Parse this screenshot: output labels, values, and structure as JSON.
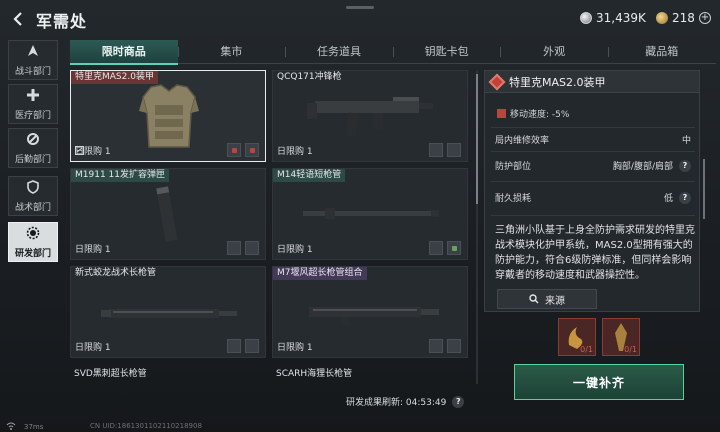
{
  "header": {
    "title": "军需处",
    "back_icon": "back-arrow-icon",
    "currency_coins": "31,439K",
    "currency_tokens": "218"
  },
  "sidebar": {
    "items": [
      {
        "label": "战斗部门",
        "icon": "combat-icon",
        "active": false
      },
      {
        "label": "医疗部门",
        "icon": "medical-cross-icon",
        "active": false
      },
      {
        "label": "后勤部门",
        "icon": "logistics-icon",
        "active": false
      },
      {
        "label": "战术部门",
        "icon": "shield-icon",
        "active": false
      },
      {
        "label": "研发部门",
        "icon": "rd-gear-icon",
        "active": true
      }
    ]
  },
  "tabs": [
    {
      "label": "限时商品",
      "active": true
    },
    {
      "label": "集市",
      "active": false
    },
    {
      "label": "任务道具",
      "active": false
    },
    {
      "label": "钥匙卡包",
      "active": false
    },
    {
      "label": "外观",
      "active": false
    },
    {
      "label": "藏品箱",
      "active": false
    }
  ],
  "items": [
    {
      "name": "特里克MAS2.0装甲",
      "limit": "日限购 1",
      "selected": true
    },
    {
      "name": "QCQ171冲锋枪",
      "limit": "日限购 1",
      "selected": false
    },
    {
      "name": "M1911 11发扩容弹匣",
      "limit": "日限购 1",
      "selected": false
    },
    {
      "name": "M14轻语短枪管",
      "limit": "日限购 1",
      "selected": false
    },
    {
      "name": "新式蛟龙战术长枪管",
      "limit": "日限购 1",
      "selected": false
    },
    {
      "name": "M7堰风超长枪管组合",
      "limit": "日限购 1",
      "selected": false
    },
    {
      "name": "SVD黑刺超长枪管",
      "limit": "",
      "selected": false
    },
    {
      "name": "SCARH海狸长枪管",
      "limit": "",
      "selected": false
    }
  ],
  "refresh": {
    "label": "研发成果刷新: 04:53:49"
  },
  "detail": {
    "title": "特里克MAS2.0装甲",
    "move_speed": "移动速度: -5%",
    "rows": [
      {
        "label": "局内维修效率",
        "value": "中"
      },
      {
        "label": "防护部位",
        "value": "胸部/腹部/肩部"
      },
      {
        "label": "耐久损耗",
        "value": "低"
      }
    ],
    "description": "三角洲小队基于上身全防护需求研发的特里克战术模块化护甲系统，MAS2.0型拥有强大的防护能力，符合6级防弹标准，但同样会影响穿戴者的移动速度和武器操控性。",
    "source_label": "来源",
    "materials": [
      {
        "count": "0/1"
      },
      {
        "count": "0/1"
      }
    ],
    "restock_label": "一键补齐"
  },
  "footer": {
    "ping": "37ms",
    "uid": "CN UID:1861301102110218908"
  },
  "colors": {
    "accent": "#5fd1b8",
    "danger": "#c2423a",
    "button_green": "#59d39b"
  }
}
